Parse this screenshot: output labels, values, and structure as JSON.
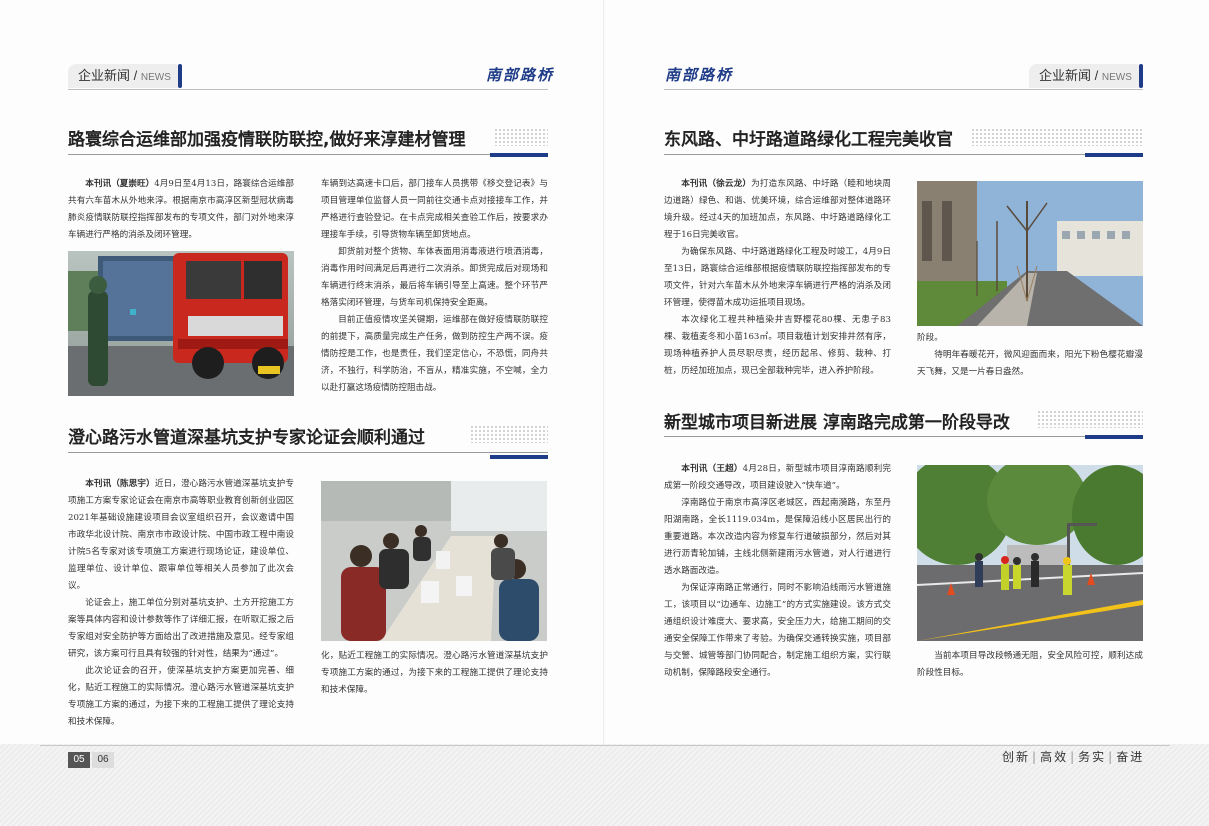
{
  "header": {
    "section_cn": "企业新闻",
    "section_sep": " / ",
    "section_en": "NEWS",
    "brand": "南部路桥"
  },
  "left": {
    "article1": {
      "title": "路寰综合运维部加强疫情联防联控,做好来淳建材管理",
      "byline": "本刊讯（夏崇旺）",
      "p1": "4月9日至4月13日，路寰综合运维部共有六车苗木从外地来淳。根据南京市高淳区新型冠状病毒肺炎疫情联防联控指挥部发布的专项文件，部门对外地来淳车辆进行严格的消杀及闭环管理。",
      "p2": "车辆到达高速卡口后，部门接车人员携带《移交登记表》与项目管理单位监督人员一同前往交通卡点对接接车工作，并严格进行查验登记。在卡点完成相关查验工作后，按要求办理接车手续，引导货物车辆至卸货地点。",
      "p3": "卸货前对整个货物、车体表面用消毒液进行喷洒消毒，消毒作用时间满足后再进行二次消杀。卸货完成后对现场和车辆进行终末消杀，最后将车辆引导至上高速。整个环节严格落实闭环管理，与货车司机保持安全距离。",
      "p4": "目前正值疫情攻坚关键期，运维部在做好疫情联防联控的前提下，高质量完成生产任务，做到防控生产两不误。疫情防控是工作，也是责任，我们坚定信心，不恐慌，同舟共济，不独行，科学防治，不盲从，精准实施，不空喊，全力以赴打赢这场疫情防控阻击战。"
    },
    "article2": {
      "title": "澄心路污水管道深基坑支护专家论证会顺利通过",
      "byline": "本刊讯（陈思宇）",
      "p1": "近日，澄心路污水管道深基坑支护专项施工方案专家论证会在南京市高等职业教育创新创业园区2021年基础设施建设项目会议室组织召开，会议邀请中国市政华北设计院、南京市市政设计院、中国市政工程中南设计院5名专家对该专项施工方案进行现场论证，建设单位、监理单位、设计单位、跟审单位等相关人员参加了此次会议。",
      "p2": "论证会上，施工单位分别对基坑支护、土方开挖施工方案等具体内容和设计参数等作了详细汇报，在听取汇报之后专家组对安全防护等方面给出了改进措施及意见。经专家组研究，该方案可行且具有较强的针对性，结果为“通过”。",
      "p3": "此次论证会的召开，使深基坑支护方案更加完善、细化，贴近工程施工的实际情况。澄心路污水管道深基坑支护专项施工方案的通过，为接下来的工程施工提供了理论支持和技术保障。"
    },
    "page_numbers": [
      "05",
      "06"
    ]
  },
  "right": {
    "article3": {
      "title": "东风路、中圩路道路绿化工程完美收官",
      "byline": "本刊讯（徐云龙）",
      "p1": "为打造东风路、中圩路（睦和地块周边道路）绿色、和谐、优美环境，综合运维部对整体道路环境升级。经过4天的加班加点，东风路、中圩路道路绿化工程于16日完美收官。",
      "p2": "为确保东风路、中圩路道路绿化工程及时竣工，4月9日至13日，路寰综合运维部根据疫情联防联控指挥部发布的专项文件，针对六车苗木从外地来淳车辆进行严格的消杀及闭环管理，使得苗木成功运抵项目现场。",
      "p3": "本次绿化工程共种植染井吉野樱花80棵、无患子83棵、栽植麦冬和小苗163㎡。项目栽植计划安排井然有序，现场种植养护人员尽职尽责，经历起吊、修剪、栽种、打桩，历经加班加点，现已全部栽种完毕，进入养护阶段。",
      "p4": "待明年春暖花开，微风迎面而来，阳光下粉色樱花瓣漫天飞舞，又是一片春日盎然。"
    },
    "article4": {
      "title": "新型城市项目新进展 淳南路完成第一阶段导改",
      "byline": "本刊讯（王超）",
      "p1": "4月28日，新型城市项目淳南路顺利完成第一阶段交通导改，项目建设驶入“快车道”。",
      "p2": "淳南路位于南京市高淳区老城区，西起南漪路，东至丹阳湖南路，全长1119.034m，是保障沿线小区居民出行的重要道路。本次改造内容为修复车行道破损部分，然后对其进行沥青轮加铺，主线北侧新建雨污水管道，对人行道进行透水路面改造。",
      "p3": "为保证淳南路正常通行，同时不影响沿线雨污水管道施工，该项目以“边通车、边施工”的方式实施建设。该方式交通组织设计难度大、要求高，安全压力大，给施工期间的交通安全保障工作带来了考验。为确保交通转换实施，项目部与交警、城管等部门协同配合，制定施工组织方案，实行联动机制，保障路段安全通行。",
      "p4": "当前本项目导改段畅通无阻，安全风险可控，顺利达成阶段性目标。"
    },
    "slogan": [
      "创新",
      "高效",
      "务实",
      "奋进"
    ]
  },
  "colors": {
    "accent_blue": "#1f3c88",
    "page_num_dark": "#555555",
    "page_num_light": "#dddddd"
  }
}
